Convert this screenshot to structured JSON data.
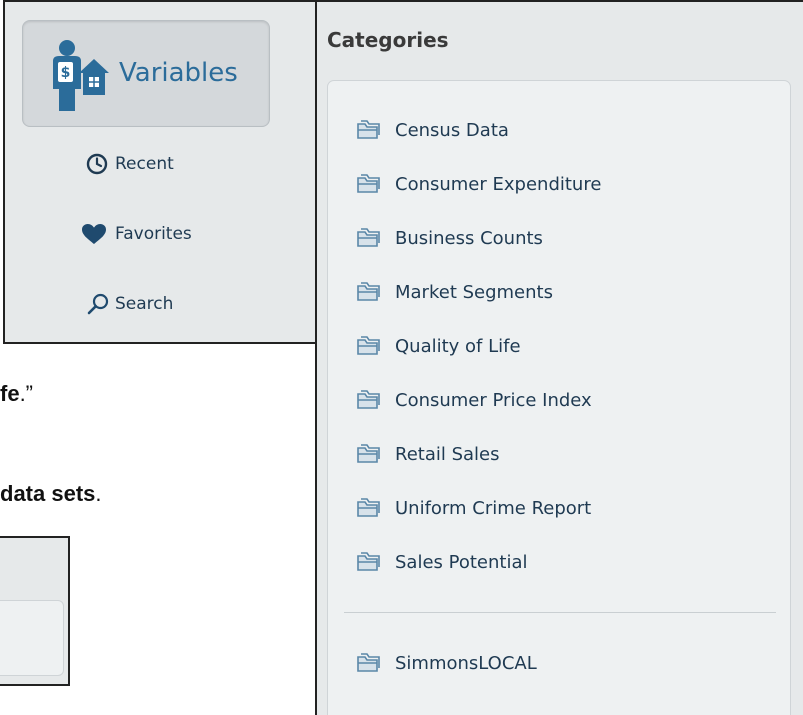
{
  "doc": {
    "line1_prefix": "fe",
    "line1_suffix": ".”",
    "line2_bold": "data sets",
    "line2_suffix": "."
  },
  "nav": {
    "active": {
      "label": "Variables",
      "icon": "person-building-icon"
    },
    "items": [
      {
        "label": "Recent",
        "icon": "clock-icon"
      },
      {
        "label": "Favorites",
        "icon": "heart-icon"
      },
      {
        "label": "Search",
        "icon": "search-icon"
      }
    ]
  },
  "categories": {
    "header": "Categories",
    "items": [
      "Census Data",
      "Consumer Expenditure",
      "Business Counts",
      "Market Segments",
      "Quality of Life",
      "Consumer Price Index",
      "Retail Sales",
      "Uniform Crime Report",
      "Sales Potential"
    ],
    "extra": [
      "SimmonsLOCAL"
    ]
  },
  "colors": {
    "accent": "#2b6c9a",
    "panel_bg": "#e6e9ea",
    "folder": "#5a87a8"
  }
}
